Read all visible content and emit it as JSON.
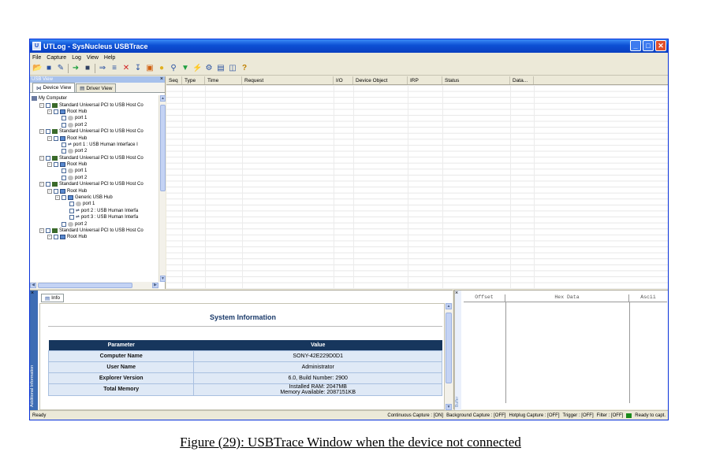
{
  "window": {
    "title": "UTLog - SysNucleus USBTrace",
    "buttons": {
      "min": "_",
      "max": "□",
      "close": "✕"
    }
  },
  "menu": [
    "File",
    "Capture",
    "Log",
    "View",
    "Help"
  ],
  "toolbar_icons": [
    "open-icon",
    "save-icon",
    "edit-icon",
    "start-icon",
    "stop-icon",
    "insert-icon",
    "filter-list-icon",
    "delete-icon",
    "download-icon",
    "import-icon",
    "bulb-icon",
    "search-icon",
    "funnel-icon",
    "trigger-icon",
    "device-icon",
    "report-icon",
    "export-icon",
    "help-icon"
  ],
  "left_pane": {
    "caption": "USB View",
    "tabs": [
      "Device View",
      "Driver View"
    ],
    "tree": [
      {
        "indent": 0,
        "expander": "",
        "checkbox": false,
        "icon": "mc",
        "label": "My Computer"
      },
      {
        "indent": 1,
        "expander": "-",
        "checkbox": true,
        "icon": "pc",
        "label": "Standard Universal PCI to USB Host Co"
      },
      {
        "indent": 2,
        "expander": "-",
        "checkbox": true,
        "icon": "hub",
        "label": "Root Hub"
      },
      {
        "indent": 3,
        "expander": "",
        "checkbox": true,
        "icon": "port",
        "label": "port 1"
      },
      {
        "indent": 3,
        "expander": "",
        "checkbox": true,
        "icon": "port",
        "label": "port 2"
      },
      {
        "indent": 1,
        "expander": "-",
        "checkbox": true,
        "icon": "pc",
        "label": "Standard Universal PCI to USB Host Co"
      },
      {
        "indent": 2,
        "expander": "-",
        "checkbox": true,
        "icon": "hub",
        "label": "Root Hub"
      },
      {
        "indent": 3,
        "expander": "",
        "checkbox": true,
        "icon": "usb",
        "label": "port 1 : USB Human Interface I"
      },
      {
        "indent": 3,
        "expander": "",
        "checkbox": true,
        "icon": "port",
        "label": "port 2"
      },
      {
        "indent": 1,
        "expander": "-",
        "checkbox": true,
        "icon": "pc",
        "label": "Standard Universal PCI to USB Host Co"
      },
      {
        "indent": 2,
        "expander": "-",
        "checkbox": true,
        "icon": "hub",
        "label": "Root Hub"
      },
      {
        "indent": 3,
        "expander": "",
        "checkbox": true,
        "icon": "port",
        "label": "port 1"
      },
      {
        "indent": 3,
        "expander": "",
        "checkbox": true,
        "icon": "port",
        "label": "port 2"
      },
      {
        "indent": 1,
        "expander": "-",
        "checkbox": true,
        "icon": "pc",
        "label": "Standard Universal PCI to USB Host Co"
      },
      {
        "indent": 2,
        "expander": "-",
        "checkbox": true,
        "icon": "hub",
        "label": "Root Hub"
      },
      {
        "indent": 3,
        "expander": "-",
        "checkbox": true,
        "icon": "hub",
        "label": "Generic USB Hub"
      },
      {
        "indent": 4,
        "expander": "",
        "checkbox": true,
        "icon": "port",
        "label": "port 1"
      },
      {
        "indent": 4,
        "expander": "",
        "checkbox": true,
        "icon": "usb",
        "label": "port 2 : USB Human Interfa"
      },
      {
        "indent": 4,
        "expander": "",
        "checkbox": true,
        "icon": "usb",
        "label": "port 3 : USB Human Interfa"
      },
      {
        "indent": 3,
        "expander": "",
        "checkbox": true,
        "icon": "port",
        "label": "port 2"
      },
      {
        "indent": 1,
        "expander": "-",
        "checkbox": true,
        "icon": "pc",
        "label": "Standard Universal PCI to USB Host Co"
      },
      {
        "indent": 2,
        "expander": "-",
        "checkbox": true,
        "icon": "hub",
        "label": "Root Hub"
      }
    ]
  },
  "trace_columns": [
    "Seq",
    "Type",
    "Time",
    "Request",
    "I/O",
    "Device Object",
    "IRP",
    "Status",
    "Data..."
  ],
  "info_panel": {
    "tab": "Info",
    "side_label": "Additional Information",
    "heading": "System Information",
    "table_headers": [
      "Parameter",
      "Value"
    ],
    "rows": [
      {
        "param": "Computer Name",
        "value": "SONY-42E229D0D1"
      },
      {
        "param": "User Name",
        "value": "Administrator"
      },
      {
        "param": "Explorer Version",
        "value": "6.0, Build Number: 2900"
      },
      {
        "param": "Total Memory",
        "value": "Installed RAM: 2047MB\nMemory Available: 2087151KB"
      }
    ]
  },
  "hex_panel": {
    "columns": [
      "Offset",
      "Hex Data",
      "Ascii"
    ],
    "side_label": "Buffer"
  },
  "status_bar": {
    "ready": "Ready",
    "continuous": "Continuous Capture : [ON]",
    "background": "Background Capture : [OFF]",
    "hotplug": "Hotplug Capture : [OFF]",
    "trigger": "Trigger : [OFF]",
    "filter": "Filter : [OFF]",
    "ready_to_capture": "Ready to capt."
  },
  "caption": "Figure (29): USBTrace Window when the device not connected"
}
